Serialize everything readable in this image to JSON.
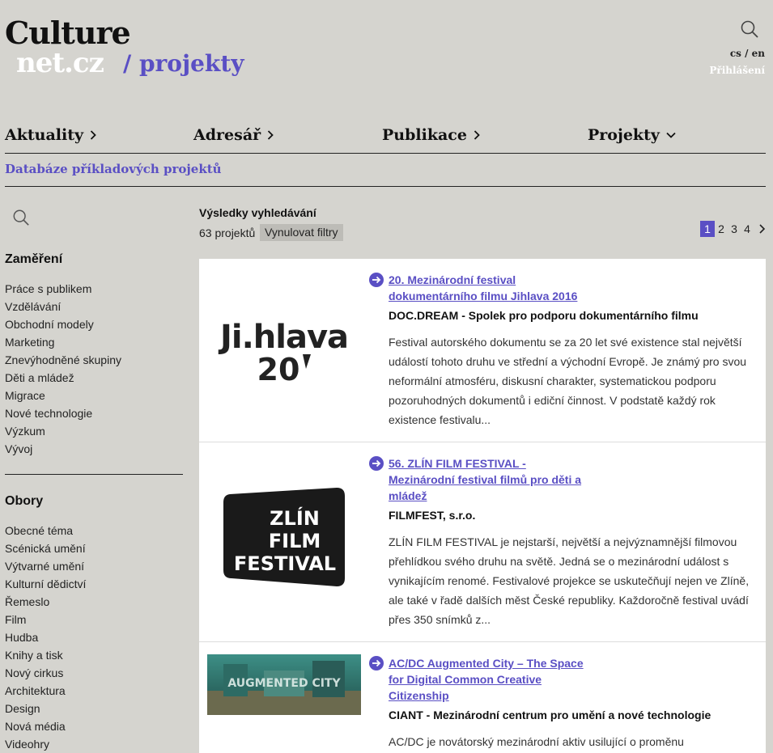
{
  "logo": {
    "culture": "Culture",
    "net": "net.cz",
    "section": "/ projekty"
  },
  "header": {
    "lang": "cs / en",
    "login": "Přihlášení"
  },
  "nav": [
    {
      "label": "Aktuality"
    },
    {
      "label": "Adresář"
    },
    {
      "label": "Publikace"
    },
    {
      "label": "Projekty"
    }
  ],
  "subnav": {
    "label": "Databáze příkladových projektů"
  },
  "sidebar": {
    "focus_heading": "Zaměření",
    "focus_items": [
      "Práce s publikem",
      "Vzdělávání",
      "Obchodní modely",
      "Marketing",
      "Znevýhodněné skupiny",
      "Děti a mládež",
      "Migrace",
      "Nové technologie",
      "Výzkum",
      "Vývoj"
    ],
    "fields_heading": "Obory",
    "fields_items": [
      "Obecné téma",
      "Scénická umění",
      "Výtvarné umění",
      "Kulturní dědictví",
      "Řemeslo",
      "Film",
      "Hudba",
      "Knihy a tisk",
      "Nový cirkus",
      "Architektura",
      "Design",
      "Nová média",
      "Videohry"
    ]
  },
  "results": {
    "title": "Výsledky vyhledávání",
    "count": "63 projektů",
    "reset": "Vynulovat filtry",
    "pages": [
      "1",
      "2",
      "3",
      "4"
    ],
    "active_page": "1"
  },
  "cards": [
    {
      "title_line1": "20. Mezinárodní festival",
      "title_line2": "dokumentárního filmu Jihlava 2016",
      "org": "DOC.DREAM - Spolek pro podporu dokumentárního filmu",
      "desc": "Festival autorského dokumentu se za 20 let své existence stal největší událostí tohoto druhu ve střední a východní Evropě. Je známý pro svou neformální atmosféru, diskusní charakter, systematickou podporu pozoruhodných dokumentů i ediční činnost. V podstatě každý rok existence festivalu...",
      "logo_text_1": "Ji.hlava",
      "logo_text_2": "20"
    },
    {
      "title_line1": "56. ZLÍN FILM FESTIVAL -",
      "title_line2": "Mezinárodní festival filmů pro děti a",
      "title_line3": "mládež",
      "org": "FILMFEST, s.r.o.",
      "desc": "ZLÍN FILM FESTIVAL je nejstarší, největší a nejvýznamnější filmovou přehlídkou svého druhu na světě. Jedná se o mezinárodní událost s vynikajícím renomé. Festivalové projekce se uskutečňují nejen ve Zlíně, ale také v řadě dalších měst České republiky. Každoročně festival uvádí přes 350 snímků z...",
      "logo_text_1": "ZLÍN",
      "logo_text_2": "FILM",
      "logo_text_3": "FESTIVAL"
    },
    {
      "title_line1": "AC/DC Augmented City – The Space",
      "title_line2": "for Digital Common Creative",
      "title_line3": "Citizenship",
      "org": "CIANT - Mezinárodní centrum pro umění a nové technologie",
      "desc": "AC/DC je novátorský mezinárodní aktiv usilující o proměnu",
      "logo_text_1": "AUGMENTED CITY"
    }
  ]
}
